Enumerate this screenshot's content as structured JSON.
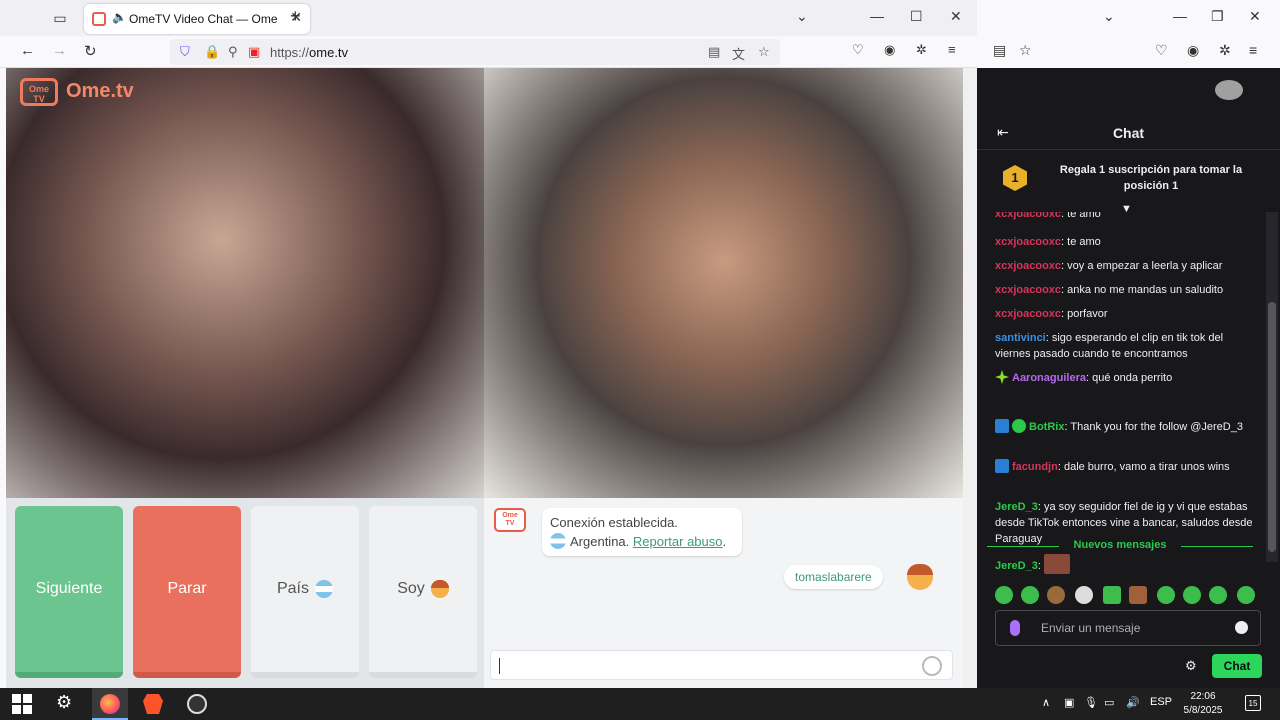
{
  "browser": {
    "tab_title": "OmeTV Video Chat — Ome",
    "url_scheme": "https://",
    "url_host": "ome.tv"
  },
  "ometv": {
    "logo_box": "Ome TV",
    "logo_name": "Ome.tv",
    "buttons": {
      "next": "Siguiente",
      "stop": "Parar",
      "country": "País",
      "soy": "Soy"
    },
    "system_message": {
      "line1": "Conexión establecida.",
      "country": "Argentina.",
      "report": "Reportar abuso",
      "period": "."
    },
    "my_name": "tomaslabarere"
  },
  "twitch": {
    "title": "Chat",
    "promo_rank": "1",
    "promo_text": "Regala 1 suscripción para tomar la posición 1",
    "messages": [
      {
        "user": "xcxjoacooxc",
        "text": ": te amo",
        "color": "red"
      },
      {
        "user": "xcxjoacooxc",
        "text": ": te amo",
        "color": "red"
      },
      {
        "user": "xcxjoacooxc",
        "text": ": voy a empezar a leerla y aplicar",
        "color": "red"
      },
      {
        "user": "xcxjoacooxc",
        "text": ": anka no me mandas un saludito",
        "color": "red"
      },
      {
        "user": "xcxjoacooxc",
        "text": ": porfavor",
        "color": "red"
      },
      {
        "user": "santivinci",
        "text": ": sigo esperando el clip en tik tok del viernes pasado cuando te encontramos",
        "color": "blue"
      },
      {
        "user": "Aaronaguilera",
        "text": ": qué onda perrito",
        "color": "purple"
      },
      {
        "user": "BotRix",
        "text": ": Thank you for the follow @JereD_3",
        "color": "green"
      },
      {
        "user": "facundjn",
        "text": ": dale burro, vamo a tirar unos wins",
        "color": "red"
      },
      {
        "user": "JereD_3",
        "text": ": ya soy seguidor fiel de ig y vi que estabas desde TikTok entonces vine a bancar, saludos desde Paraguay",
        "color": "green"
      },
      {
        "user": "JereD_3",
        "text": ":",
        "color": "green"
      }
    ],
    "new_messages": "Nuevos mensajes",
    "input_placeholder": "Enviar un mensaje",
    "chat_button": "Chat"
  },
  "taskbar": {
    "lang": "ESP",
    "time": "22:06",
    "date": "5/8/2025",
    "notifications": "15"
  }
}
